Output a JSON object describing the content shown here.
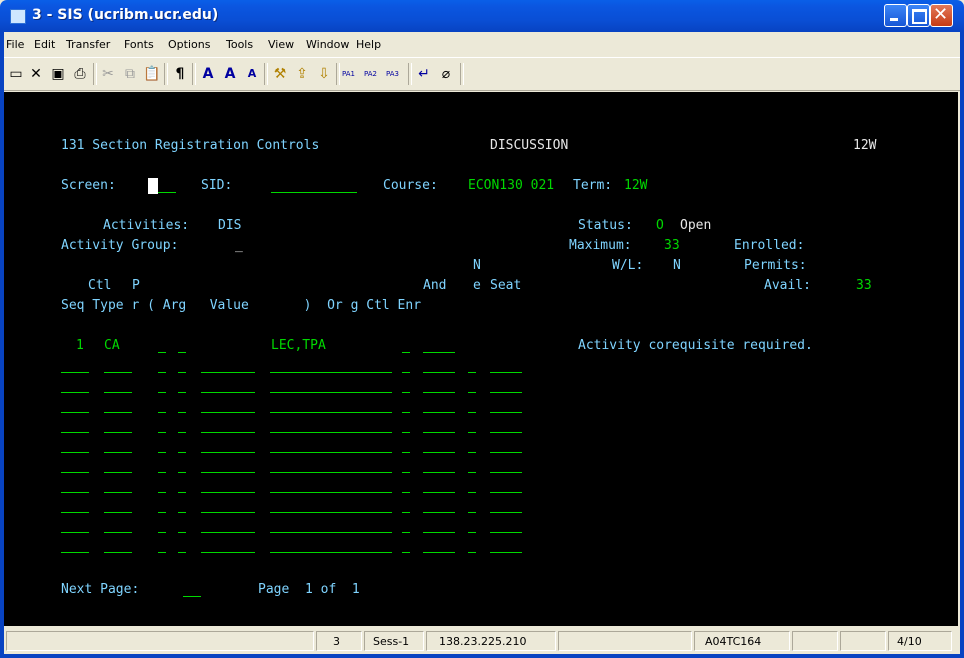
{
  "window": {
    "title": "3 - SIS (ucribm.ucr.edu)"
  },
  "menu": [
    "File",
    "Edit",
    "Transfer",
    "Fonts",
    "Options",
    "Tools",
    "View",
    "Window",
    "Help"
  ],
  "toolbar": {
    "pa1": "PA1",
    "pa2": "PA2",
    "pa3": "PA3"
  },
  "screen": {
    "heading": "131 Section Registration Controls",
    "mode": "DISCUSSION",
    "term_code": "12W",
    "screen_label": "Screen:",
    "screen_value": "",
    "sid_label": "SID:",
    "sid_value": "",
    "course_label": "Course:",
    "course_value": "ECON130 021",
    "term_label": "Term:",
    "term_value": "12W",
    "activities_label": "Activities:",
    "activities_value": "DIS",
    "activity_group_label": "Activity Group:",
    "activity_group_value": "_",
    "status_label": "Status:",
    "status_code": "O",
    "status_text": "Open",
    "maximum_label": "Maximum:",
    "maximum_value": "33",
    "enrolled_label": "Enrolled:",
    "enrolled_value": "",
    "wl_label": "W/L:",
    "wl_value": "N",
    "permits_label": "Permits:",
    "permits_value": "",
    "avail_label": "Avail:",
    "avail_value": "33",
    "headers": {
      "row1": "N",
      "row2_ctl": "Ctl",
      "row2_p": "P",
      "row2_and": "And",
      "row2_e": "e",
      "row2_seat": "Seat",
      "row3": "Seq Type r ( Arg   Value       )  Or g Ctl Enr"
    },
    "row1": {
      "seq": "1",
      "type": "CA",
      "value": "LEC,TPA",
      "message": "Activity corequisite required."
    },
    "next_page_label": "Next Page:",
    "page_text": "Page  1 of  1"
  },
  "status": {
    "num": "3",
    "session": "Sess-1",
    "ip": "138.23.225.210",
    "lu": "A04TC164",
    "cursor": "4/10"
  }
}
